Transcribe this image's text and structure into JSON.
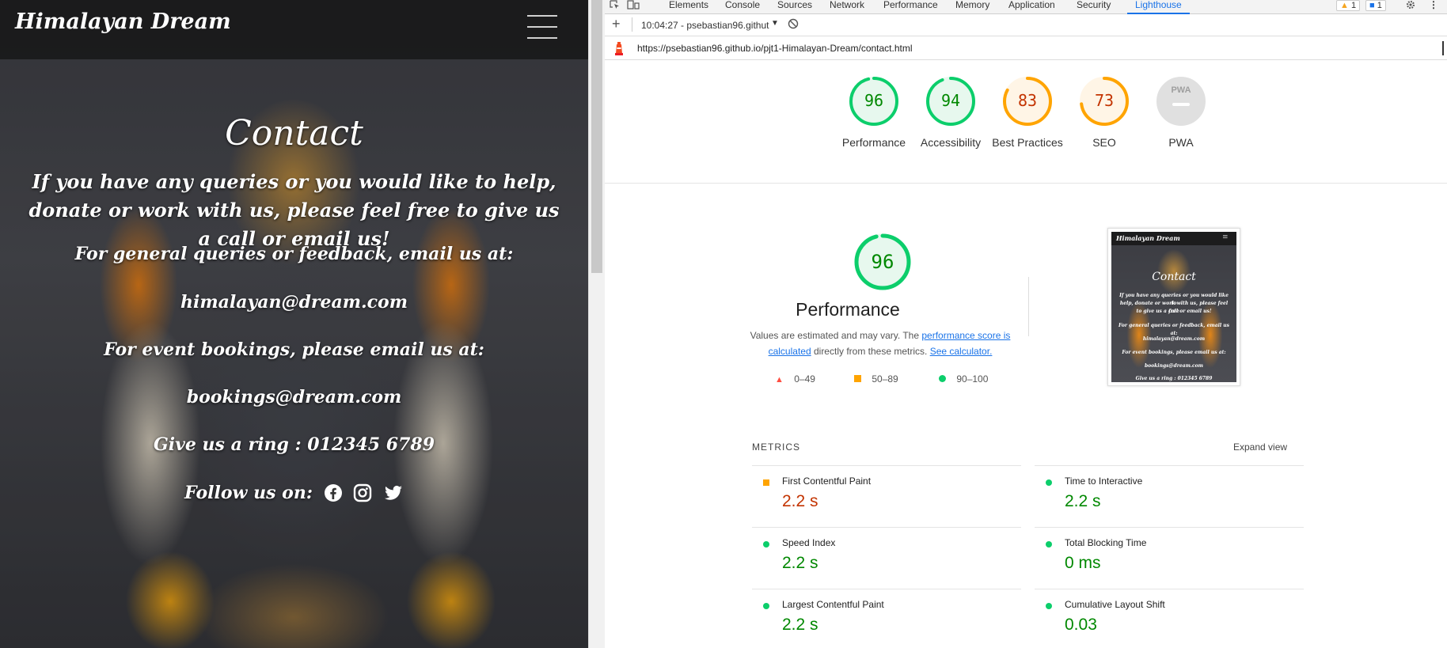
{
  "site": {
    "logo": "Himalayan Dream",
    "heading": "Contact",
    "intro": "If you have any queries or you would like to help, donate or work with us, please feel free to give us a call or email us!",
    "general_label": "For general queries or feedback, email us at:",
    "general_email": "himalayan@dream.com",
    "events_label": "For event bookings, please email us at:",
    "events_email": "bookings@dream.com",
    "phone": "Give us a ring : 012345 6789",
    "follow_label": "Follow us on:"
  },
  "devtools": {
    "tabs": [
      "Elements",
      "Console",
      "Sources",
      "Network",
      "Performance",
      "Memory",
      "Application",
      "Security",
      "Lighthouse"
    ],
    "warnings_count": "1",
    "messages_count": "1",
    "run_time": "10:04:27 - psebastian96.githut",
    "url": "https://psebastian96.github.io/pjt1-Himalayan-Dream/contact.html"
  },
  "lighthouse": {
    "gauges": [
      {
        "label": "Performance",
        "score": "96",
        "value": 96,
        "color": "#0cce6b",
        "text": "#008800",
        "fill": "#e7f8ee"
      },
      {
        "label": "Accessibility",
        "score": "94",
        "value": 94,
        "color": "#0cce6b",
        "text": "#008800",
        "fill": "#e7f8ee"
      },
      {
        "label": "Best Practices",
        "score": "83",
        "value": 83,
        "color": "#ffa400",
        "text": "#c33300",
        "fill": "#fff5e6"
      },
      {
        "label": "SEO",
        "score": "73",
        "value": 73,
        "color": "#ffa400",
        "text": "#c33300",
        "fill": "#fff5e6"
      },
      {
        "label": "PWA",
        "score": "",
        "value": 0,
        "color": "#e0e0e0",
        "text": "#999999",
        "fill": "#e0e0e0"
      }
    ],
    "pwa_badge": "PWA",
    "performance": {
      "score": "96",
      "value": 96,
      "title": "Performance",
      "desc_before": "Values are estimated and may vary. The ",
      "desc_link1": "performance score is calculated",
      "desc_middle": " directly from these metrics. ",
      "desc_link2": "See calculator."
    },
    "legend": [
      {
        "range": "0–49",
        "shape": "triangle",
        "color": "#ff4e42"
      },
      {
        "range": "50–89",
        "shape": "square",
        "color": "#ffa400"
      },
      {
        "range": "90–100",
        "shape": "circle",
        "color": "#0cce6b"
      }
    ],
    "thumbnail": {
      "logo": "Himalayan Dream",
      "heading": "Contact",
      "lines": [
        "If you have any queries or you would like to",
        "help, donate or work with us, please feel free",
        "to give us a call or email us!",
        "For general queries or feedback, email us at:",
        "himalayan@dream.com",
        "For event bookings, please email us at:",
        "bookings@dream.com",
        "Give us a ring : 012345 6789"
      ]
    },
    "metrics_title": "METRICS",
    "expand_view": "Expand view",
    "metrics": [
      {
        "label": "First Contentful Paint",
        "value": "2.2 s",
        "status": "average",
        "color": "#c33300",
        "dot": "#ffa400"
      },
      {
        "label": "Time to Interactive",
        "value": "2.2 s",
        "status": "pass",
        "color": "#008800",
        "dot": "#0cce6b"
      },
      {
        "label": "Speed Index",
        "value": "2.2 s",
        "status": "pass",
        "color": "#008800",
        "dot": "#0cce6b"
      },
      {
        "label": "Total Blocking Time",
        "value": "0 ms",
        "status": "pass",
        "color": "#008800",
        "dot": "#0cce6b"
      },
      {
        "label": "Largest Contentful Paint",
        "value": "2.2 s",
        "status": "pass",
        "color": "#008800",
        "dot": "#0cce6b"
      },
      {
        "label": "Cumulative Layout Shift",
        "value": "0.03",
        "status": "pass",
        "color": "#008800",
        "dot": "#0cce6b"
      }
    ]
  }
}
